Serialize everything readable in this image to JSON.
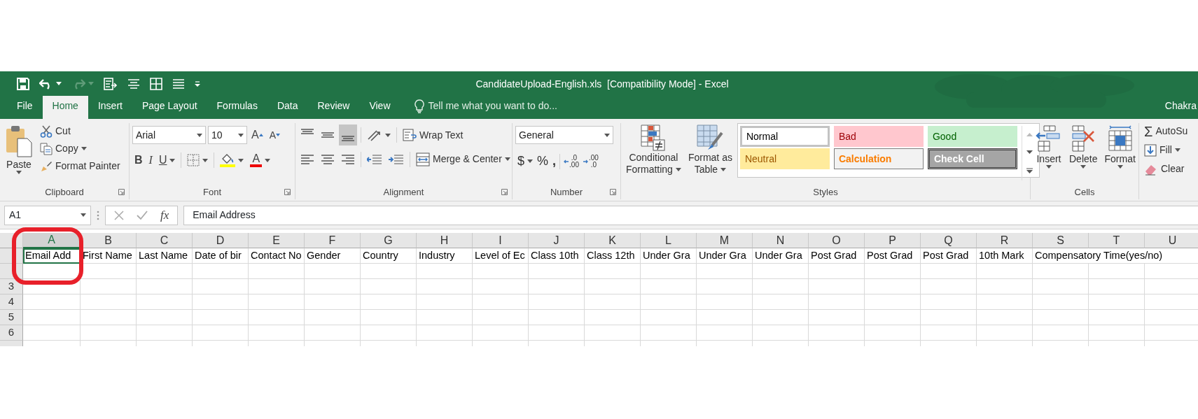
{
  "title_bar": {
    "title": "CandidateUpload-English.xls  [Compatibility Mode] - Excel",
    "redo": {
      "disabled": true
    }
  },
  "tabs": [
    {
      "label": "File",
      "selected": false
    },
    {
      "label": "Home",
      "selected": true
    },
    {
      "label": "Insert",
      "selected": false
    },
    {
      "label": "Page Layout",
      "selected": false
    },
    {
      "label": "Formulas",
      "selected": false
    },
    {
      "label": "Data",
      "selected": false
    },
    {
      "label": "Review",
      "selected": false
    },
    {
      "label": "View",
      "selected": false
    }
  ],
  "tell_me": "Tell me what you want to do...",
  "account": "Chakra",
  "clipboard": {
    "paste": "Paste",
    "cut": "Cut",
    "copy": "Copy",
    "format_painter": "Format Painter",
    "label": "Clipboard"
  },
  "font": {
    "family": "Arial",
    "size": "10",
    "grow": "A",
    "shrink": "A",
    "bold": "B",
    "italic": "I",
    "underline": "U",
    "color_letter": "A",
    "label": "Font"
  },
  "alignment": {
    "vertical": [
      {
        "selected": false
      },
      {
        "selected": false
      },
      {
        "selected": true
      }
    ],
    "wrap_text": "Wrap Text",
    "merge": "Merge & Center",
    "label": "Alignment"
  },
  "number": {
    "format": "General",
    "currency": "$",
    "percent": "%",
    "comma": ",",
    "increase_decimal": [
      ".0",
      ".00"
    ],
    "decrease_decimal": [
      ".00",
      ".0"
    ],
    "label": "Number"
  },
  "styles": {
    "conditional": [
      "Conditional",
      "Formatting"
    ],
    "format_table": [
      "Format as",
      "Table"
    ],
    "label": "Styles",
    "gallery": [
      {
        "label": "Normal",
        "kind": "normal",
        "selected": true
      },
      {
        "label": "Bad",
        "kind": "bad",
        "selected": false
      },
      {
        "label": "Good",
        "kind": "good",
        "selected": false
      },
      {
        "label": "Neutral",
        "kind": "neutral",
        "selected": false
      },
      {
        "label": "Calculation",
        "kind": "calculation",
        "selected": false
      },
      {
        "label": "Check Cell",
        "kind": "check",
        "selected": false
      }
    ]
  },
  "cells": {
    "buttons": [
      "Insert",
      "Delete",
      "Format"
    ],
    "label": "Cells"
  },
  "editing": {
    "autosum_symbol": "Σ",
    "autosum": "AutoSu",
    "fill": "Fill",
    "clear": "Clear"
  },
  "formula_bar": {
    "name_box": "A1",
    "function": "fx",
    "formula": "Email Address"
  },
  "sheet": {
    "columns": [
      {
        "label": "A",
        "selected": true
      },
      {
        "label": "B",
        "selected": false
      },
      {
        "label": "C",
        "selected": false
      },
      {
        "label": "D",
        "selected": false
      },
      {
        "label": "E",
        "selected": false
      },
      {
        "label": "F",
        "selected": false
      },
      {
        "label": "G",
        "selected": false
      },
      {
        "label": "H",
        "selected": false
      },
      {
        "label": "I",
        "selected": false
      },
      {
        "label": "J",
        "selected": false
      },
      {
        "label": "K",
        "selected": false
      },
      {
        "label": "L",
        "selected": false
      },
      {
        "label": "M",
        "selected": false
      },
      {
        "label": "N",
        "selected": false
      },
      {
        "label": "O",
        "selected": false
      },
      {
        "label": "P",
        "selected": false
      },
      {
        "label": "Q",
        "selected": false
      },
      {
        "label": "R",
        "selected": false
      },
      {
        "label": "S",
        "selected": false
      },
      {
        "label": "T",
        "selected": false
      },
      {
        "label": "U",
        "selected": false
      }
    ],
    "header_row": [
      "Email Add",
      "First Name",
      "Last Name",
      "Date of bir",
      "Contact No",
      "Gender",
      "Country",
      "Industry",
      "Level of Ec",
      "Class 10th",
      "Class 12th",
      "Under Gra",
      "Under Gra",
      "Under Gra",
      "Post Grad",
      "Post Grad",
      "Post Grad",
      "10th Mark",
      "Compensatory Time(yes/no)"
    ],
    "row_numbers": [
      "3",
      "4",
      "5",
      "6"
    ]
  },
  "annotation": {
    "kind": "ring"
  }
}
